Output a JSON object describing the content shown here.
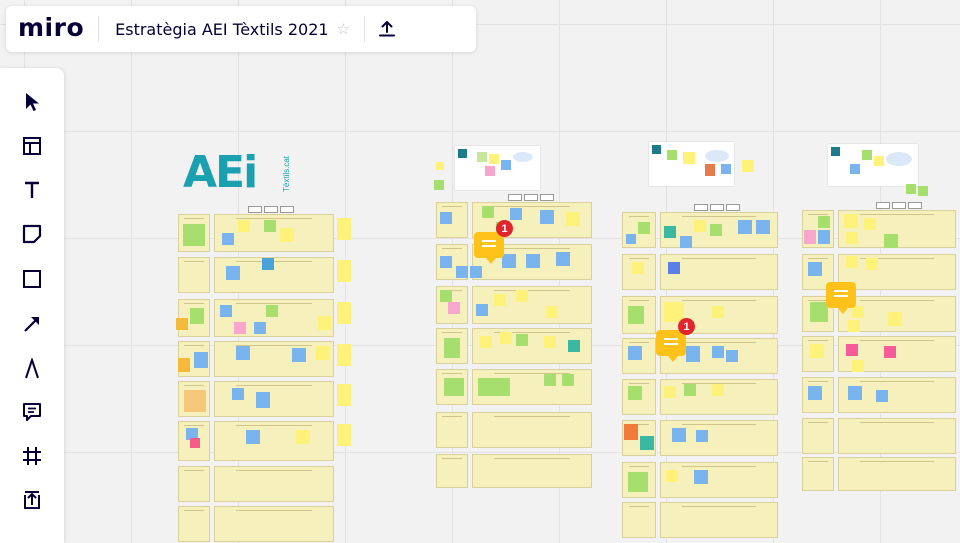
{
  "app": {
    "logo": "miro"
  },
  "board": {
    "title": "Estratègia AEI Tèxtils 2021"
  },
  "header": {
    "star_icon": "star-icon",
    "export_icon": "upload-icon"
  },
  "toolbar": {
    "tools": [
      {
        "name": "select-tool",
        "icon": "cursor-arrow-icon"
      },
      {
        "name": "templates-tool",
        "icon": "templates-icon"
      },
      {
        "name": "text-tool",
        "icon": "text-icon"
      },
      {
        "name": "sticky-note-tool",
        "icon": "sticky-note-icon"
      },
      {
        "name": "shape-tool",
        "icon": "rectangle-icon"
      },
      {
        "name": "connection-line-tool",
        "icon": "arrow-line-icon"
      },
      {
        "name": "pen-tool",
        "icon": "pen-icon"
      },
      {
        "name": "comment-tool",
        "icon": "comment-icon"
      },
      {
        "name": "frame-tool",
        "icon": "frame-icon"
      },
      {
        "name": "upload-tool",
        "icon": "upload-icon"
      }
    ]
  },
  "canvas": {
    "logo_text": "AEi",
    "logo_subtext": "Tèxtils.cat",
    "comments": [
      {
        "name": "comment-pin-1",
        "badge": "1"
      },
      {
        "name": "comment-pin-2",
        "badge": "1"
      },
      {
        "name": "comment-pin-3",
        "badge": ""
      }
    ]
  },
  "colors": {
    "frame": "#f6f0bd",
    "sticky_blue": "#7ab4ee",
    "sticky_green": "#a6df6e",
    "sticky_yellow": "#fff27a",
    "sticky_pink": "#f7a6cd",
    "comment": "#ffc21a",
    "badge": "#e0252c",
    "accent": "#050038"
  }
}
